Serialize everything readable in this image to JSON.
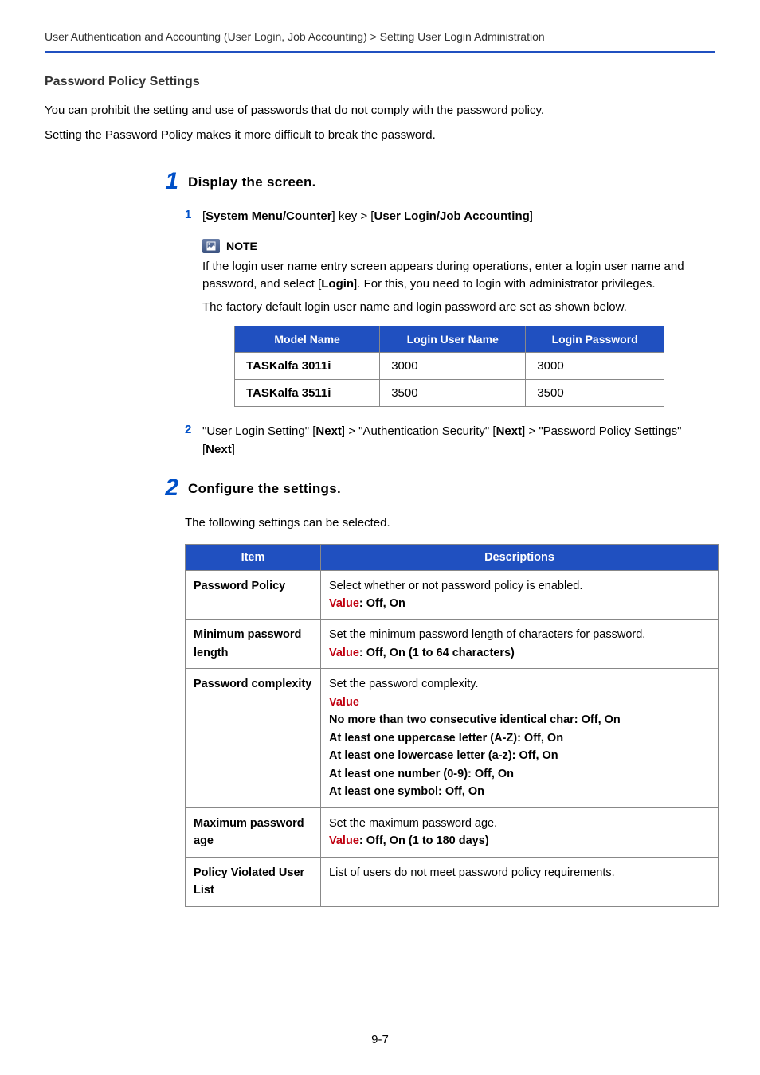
{
  "breadcrumb": "User Authentication and Accounting (User Login, Job Accounting) > Setting User Login Administration",
  "section_heading": "Password Policy Settings",
  "intro": [
    "You can prohibit the setting and use of passwords that do not comply with the password policy.",
    "Setting the Password Policy makes it more difficult to break the password."
  ],
  "step1": {
    "num": "1",
    "title": "Display the screen.",
    "sub1": {
      "num": "1",
      "pre": "[",
      "b1": "System Menu/Counter",
      "mid": "] key > [",
      "b2": "User Login/Job Accounting",
      "post": "]"
    },
    "note_label": "NOTE",
    "note_p1a": "If the login user name entry screen appears during operations, enter a login user name and password, and select [",
    "note_p1b": "Login",
    "note_p1c": "]. For this, you need to login with administrator privileges.",
    "note_p2": "The factory default login user name and login password are set as shown below.",
    "table_headers": [
      "Model Name",
      "Login User Name",
      "Login Password"
    ],
    "table_rows": [
      [
        "TASKalfa 3011i",
        "3000",
        "3000"
      ],
      [
        "TASKalfa 3511i",
        "3500",
        "3500"
      ]
    ],
    "sub2": {
      "num": "2",
      "t1": "\"User Login Setting\" [",
      "b1": "Next",
      "t2": "] > \"Authentication Security\" [",
      "b2": "Next",
      "t3": "] > \"Password Policy Settings\" [",
      "b3": "Next",
      "t4": "]"
    }
  },
  "step2": {
    "num": "2",
    "title": "Configure the settings.",
    "intro": "The following settings can be selected.",
    "headers": [
      "Item",
      "Descriptions"
    ],
    "rows": [
      {
        "item": "Password Policy",
        "desc": "Select whether or not password policy is enabled.",
        "value_label": "Value",
        "value_sep": ": ",
        "value_text": "Off, On"
      },
      {
        "item": "Minimum password length",
        "desc": "Set the minimum password length of characters for password.",
        "value_label": "Value",
        "value_sep": ": ",
        "value_text": "Off, On (1 to 64 characters)"
      },
      {
        "item": "Password complexity",
        "desc": "Set the password complexity.",
        "value_label": "Value",
        "complex_lines": [
          "No more than two consecutive identical char: Off, On",
          "At least one uppercase letter (A-Z): Off, On",
          "At least one lowercase letter (a-z): Off, On",
          "At least one number (0-9): Off, On",
          "At least one symbol: Off, On"
        ]
      },
      {
        "item": "Maximum password age",
        "desc": "Set the maximum password age.",
        "value_label": "Value",
        "value_sep": ": ",
        "value_text": "Off, On (1 to 180 days)"
      },
      {
        "item": "Policy Violated User List",
        "desc": "List of users do not meet password policy requirements."
      }
    ]
  },
  "page_no": "9-7"
}
